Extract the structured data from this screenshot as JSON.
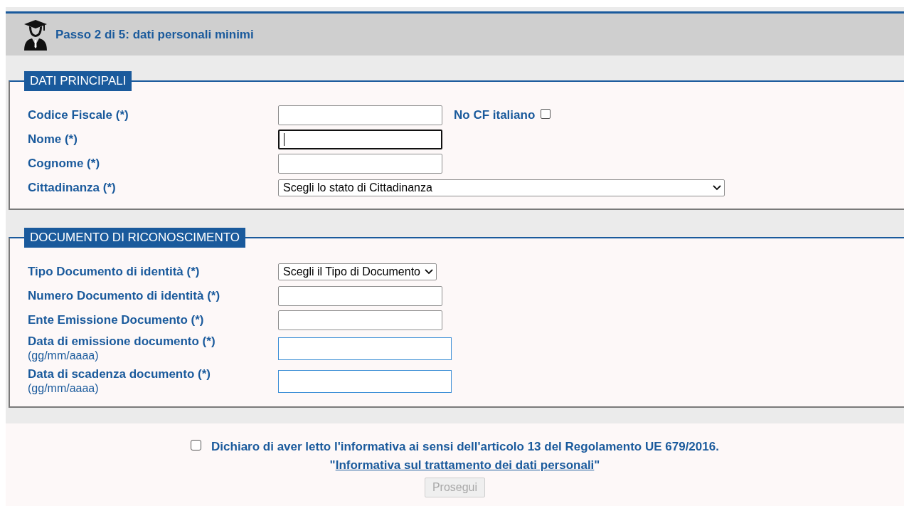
{
  "header": {
    "title": "Passo 2 di 5: dati personali minimi"
  },
  "sections": [
    {
      "legend": "DATI PRINCIPALI",
      "fields": [
        {
          "kind": "text",
          "label": "Codice Fiscale (*)",
          "focused": false,
          "extra": {
            "label": "No CF italiano",
            "checked": false
          }
        },
        {
          "kind": "text",
          "label": "Nome (*)",
          "focused": true
        },
        {
          "kind": "text",
          "label": "Cognome (*)",
          "focused": false
        },
        {
          "kind": "wide-select",
          "label": "Cittadinanza (*)",
          "value": "Scegli lo stato di Cittadinanza"
        }
      ]
    },
    {
      "legend": "DOCUMENTO DI RICONOSCIMENTO",
      "fields": [
        {
          "kind": "select",
          "label": "Tipo Documento di identità (*)",
          "value": "Scegli il Tipo di Documento"
        },
        {
          "kind": "text",
          "label": "Numero Documento di identità (*)",
          "focused": false
        },
        {
          "kind": "text",
          "label": "Ente Emissione Documento (*)",
          "focused": false
        },
        {
          "kind": "date",
          "label": "Data di emissione documento (*)",
          "hint": "(gg/mm/aaaa)"
        },
        {
          "kind": "date",
          "label": "Data di scadenza documento (*)",
          "hint": "(gg/mm/aaaa)"
        }
      ]
    }
  ],
  "consent": {
    "checked": false,
    "text": "Dichiaro di aver letto l'informativa ai sensi dell'articolo 13 del Regolamento UE 679/2016.",
    "link_open": "\"",
    "link": "Informativa sul trattamento dei dati personali",
    "link_close": "\""
  },
  "submit": {
    "label": "Prosegui",
    "disabled": true
  }
}
